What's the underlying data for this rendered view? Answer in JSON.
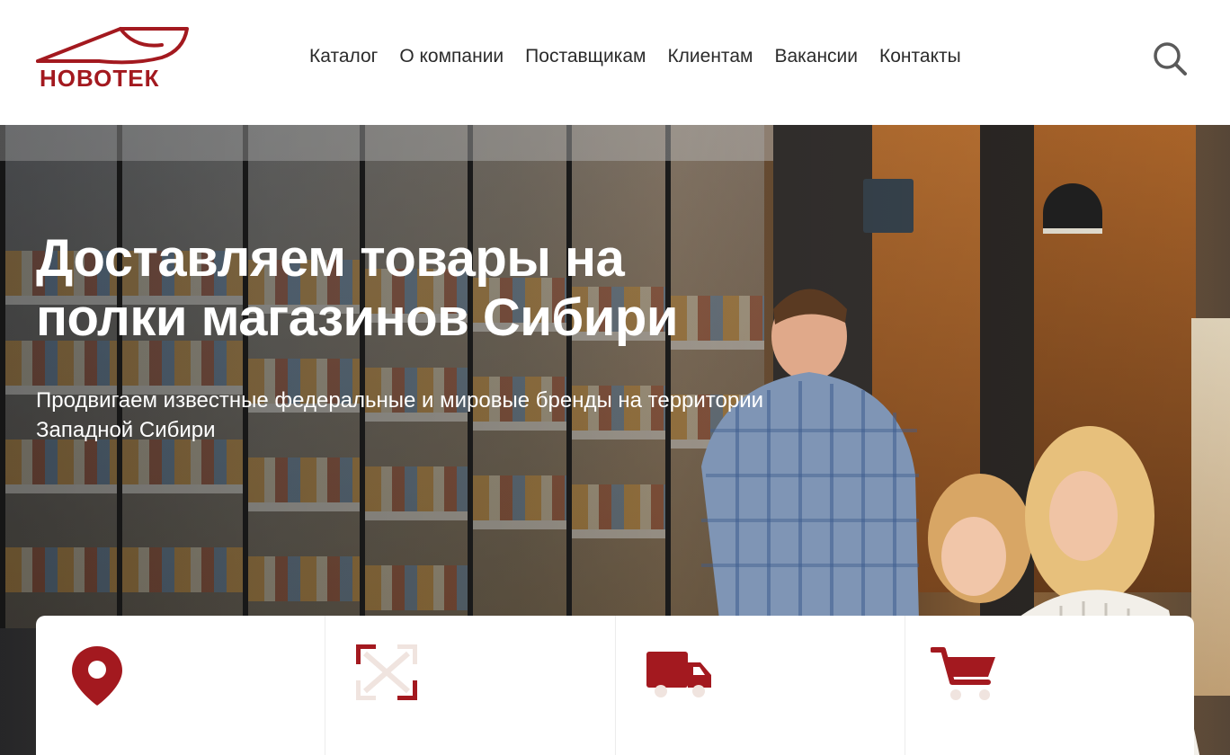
{
  "brand": {
    "name": "НОВОТЕК",
    "color": "#a3191f"
  },
  "nav": {
    "items": [
      {
        "label": "Каталог"
      },
      {
        "label": "О компании"
      },
      {
        "label": "Поставщикам"
      },
      {
        "label": "Клиентам"
      },
      {
        "label": "Вакансии"
      },
      {
        "label": "Контакты"
      }
    ],
    "search_icon": "search-icon"
  },
  "hero": {
    "title": "Доставляем товары на полки магазинов Сибири",
    "subtitle": "Продвигаем известные федеральные и мировые бренды на территории Западной Сибири"
  },
  "features": [
    {
      "icon": "location-pin-icon"
    },
    {
      "icon": "expand-arrows-icon"
    },
    {
      "icon": "delivery-truck-icon"
    },
    {
      "icon": "shopping-cart-icon"
    }
  ],
  "colors": {
    "accent": "#a3191f",
    "text": "#2b2b2b",
    "muted_icon": "#5a5a5a"
  }
}
